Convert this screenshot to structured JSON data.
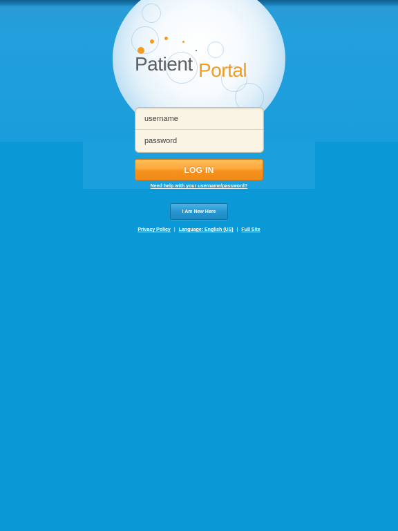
{
  "logo": {
    "word1": "Patient",
    "word2": "Portal",
    "accent_color": "#f29d1f",
    "text_color": "#5b5e63"
  },
  "login": {
    "username_placeholder": "username",
    "password_placeholder": "password",
    "submit_label": "LOG IN",
    "help_link": "Need help with your username/password?"
  },
  "new_user": {
    "button_label": "I Am New Here"
  },
  "footer": {
    "privacy_label": "Privacy Policy",
    "separator": "|",
    "language_label": "Language: English (US)",
    "full_site_label": "Full Site"
  },
  "colors": {
    "background": "#0b98d6",
    "button_orange": "#f5921f",
    "field_background": "#faf4e4"
  }
}
